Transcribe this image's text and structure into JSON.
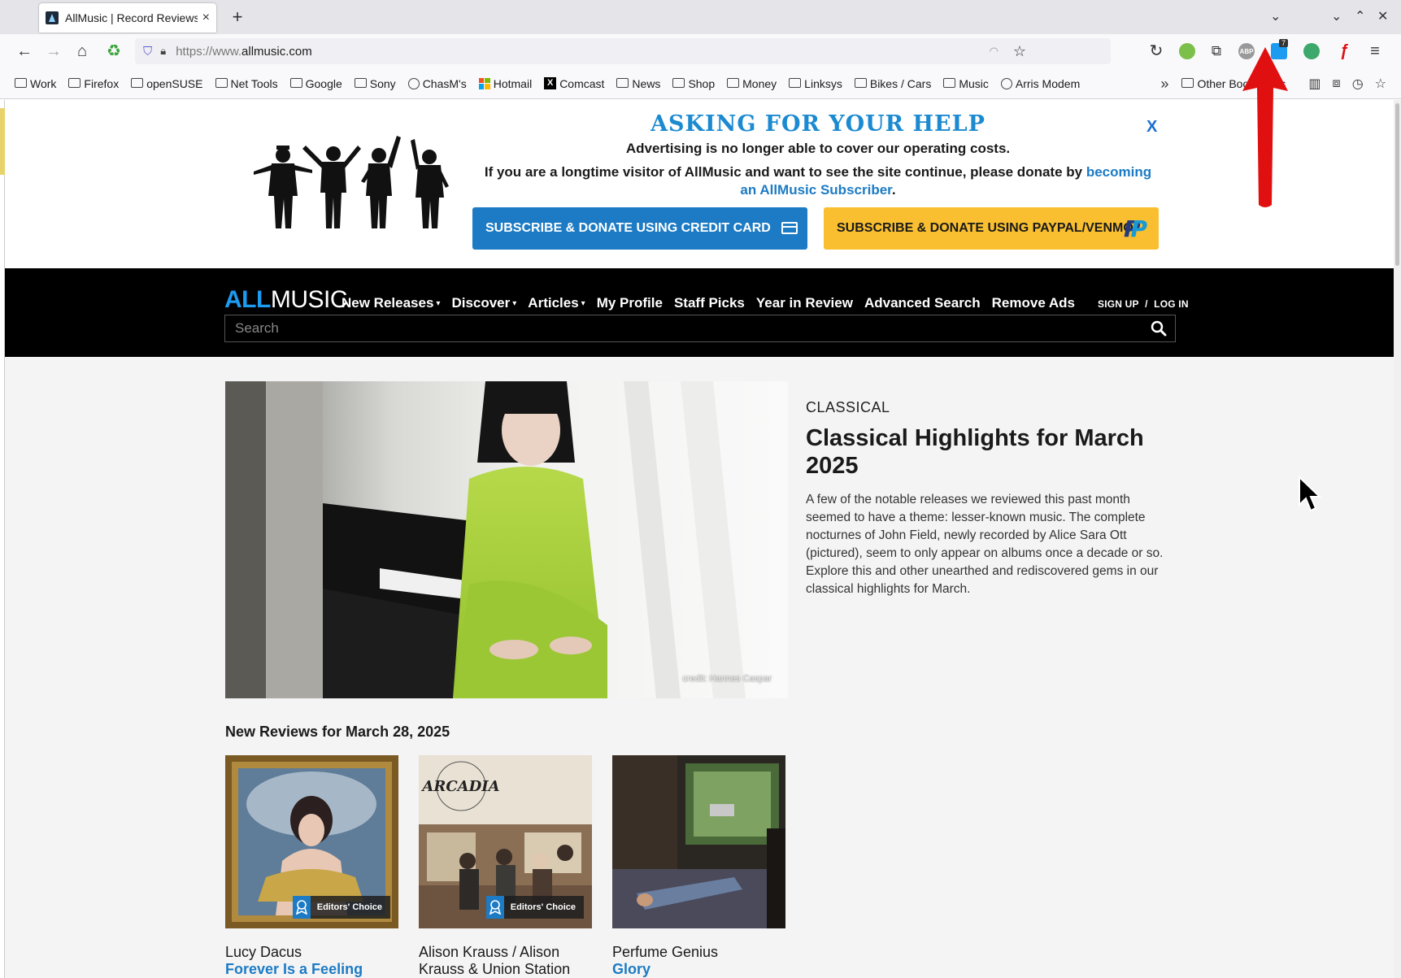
{
  "browser": {
    "tab_title": "AllMusic | Record Reviews,",
    "tab_close": "×",
    "new_tab": "+",
    "url_protocol": "https://www.",
    "url_host": "allmusic.com"
  },
  "bookmarks": [
    {
      "label": "Work",
      "icon": "folder-icon"
    },
    {
      "label": "Firefox",
      "icon": "folder-icon"
    },
    {
      "label": "openSUSE",
      "icon": "folder-icon"
    },
    {
      "label": "Net Tools",
      "icon": "folder-icon"
    },
    {
      "label": "Google",
      "icon": "folder-icon"
    },
    {
      "label": "Sony",
      "icon": "folder-icon"
    },
    {
      "label": "ChasM's",
      "icon": "globe-icon"
    },
    {
      "label": "Hotmail",
      "icon": "microsoft-icon"
    },
    {
      "label": "Comcast",
      "icon": "x-icon"
    },
    {
      "label": "News",
      "icon": "folder-icon"
    },
    {
      "label": "Shop",
      "icon": "folder-icon"
    },
    {
      "label": "Money",
      "icon": "folder-icon"
    },
    {
      "label": "Linksys",
      "icon": "folder-icon"
    },
    {
      "label": "Bikes / Cars",
      "icon": "folder-icon"
    },
    {
      "label": "Music",
      "icon": "folder-icon"
    },
    {
      "label": "Arris Modem",
      "icon": "globe-icon"
    }
  ],
  "other_bookmarks": "Other Bookmarks",
  "extensions": {
    "counter_badge": "7",
    "abp": "ABP"
  },
  "donate": {
    "headline": "ASKING FOR YOUR HELP",
    "close": "X",
    "line1": "Advertising is no longer able to cover our operating costs.",
    "line2_text": "If you are a longtime visitor of AllMusic and want to see the site continue, please donate by ",
    "line2_link": "becoming an AllMusic Subscriber",
    "line2_end": ".",
    "btn_cc": "SUBSCRIBE & DONATE USING CREDIT CARD",
    "btn_pp": "SUBSCRIBE & DONATE USING PAYPAL/VENMO"
  },
  "site": {
    "logo_all": "ALL",
    "logo_music": "MUSIC",
    "nav": [
      {
        "label": "New Releases",
        "dropdown": true
      },
      {
        "label": "Discover",
        "dropdown": true
      },
      {
        "label": "Articles",
        "dropdown": true
      },
      {
        "label": "My Profile",
        "dropdown": false
      },
      {
        "label": "Staff Picks",
        "dropdown": false
      },
      {
        "label": "Year in Review",
        "dropdown": false
      },
      {
        "label": "Advanced Search",
        "dropdown": false
      },
      {
        "label": "Remove Ads",
        "dropdown": false
      }
    ],
    "signup": "SIGN UP",
    "separator": "/",
    "login": "LOG IN",
    "search_placeholder": "Search"
  },
  "feature": {
    "genre": "CLASSICAL",
    "title": "Classical Highlights for March 2025",
    "body": "A few of the notable releases we reviewed this past month seemed to have a theme: lesser-known music. The complete nocturnes of John Field, newly recorded by Alice Sara Ott (pictured), seem to only appear on albums once a decade or so. Explore this and other unearthed and rediscovered gems in our classical highlights for March.",
    "credit": "credit: Hannes Caspar"
  },
  "reviews": {
    "title": "New Reviews for March 28, 2025",
    "items": [
      {
        "artist": "Lucy Dacus",
        "album": "Forever Is a Feeling",
        "badge": "Editors' Choice"
      },
      {
        "artist": "Alison Krauss / Alison Krauss & Union Station",
        "album": "",
        "badge": "Editors' Choice",
        "cover_text": "ARCADIA"
      },
      {
        "artist": "Perfume Genius",
        "album": "Glory",
        "badge": ""
      }
    ]
  },
  "colors": {
    "accent": "#1c7bc4",
    "logo_blue": "#1c9bf0",
    "paypal_yellow": "#f9bf30",
    "annotation_red": "#e01010"
  }
}
